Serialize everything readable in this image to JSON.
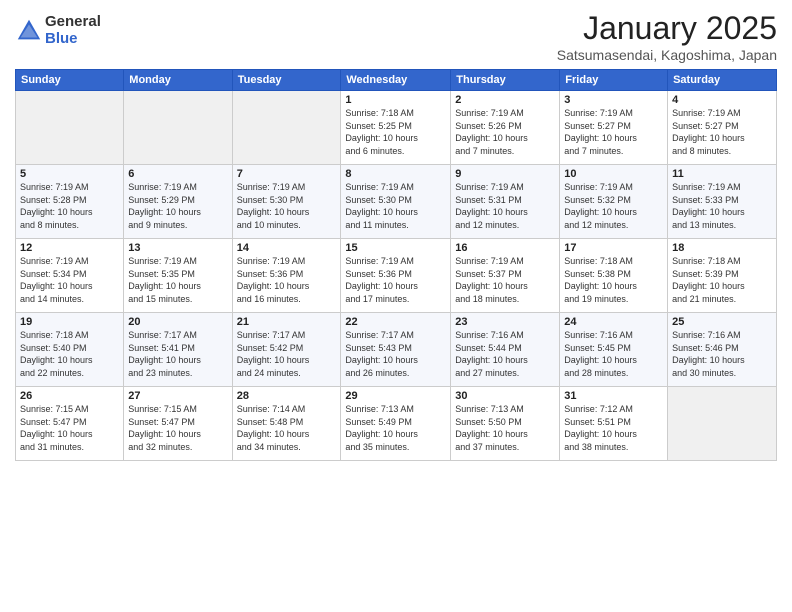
{
  "logo": {
    "general": "General",
    "blue": "Blue"
  },
  "title": {
    "month_year": "January 2025",
    "location": "Satsumasendai, Kagoshima, Japan"
  },
  "weekdays": [
    "Sunday",
    "Monday",
    "Tuesday",
    "Wednesday",
    "Thursday",
    "Friday",
    "Saturday"
  ],
  "weeks": [
    [
      {
        "day": "",
        "info": ""
      },
      {
        "day": "",
        "info": ""
      },
      {
        "day": "",
        "info": ""
      },
      {
        "day": "1",
        "info": "Sunrise: 7:18 AM\nSunset: 5:25 PM\nDaylight: 10 hours\nand 6 minutes."
      },
      {
        "day": "2",
        "info": "Sunrise: 7:19 AM\nSunset: 5:26 PM\nDaylight: 10 hours\nand 7 minutes."
      },
      {
        "day": "3",
        "info": "Sunrise: 7:19 AM\nSunset: 5:27 PM\nDaylight: 10 hours\nand 7 minutes."
      },
      {
        "day": "4",
        "info": "Sunrise: 7:19 AM\nSunset: 5:27 PM\nDaylight: 10 hours\nand 8 minutes."
      }
    ],
    [
      {
        "day": "5",
        "info": "Sunrise: 7:19 AM\nSunset: 5:28 PM\nDaylight: 10 hours\nand 8 minutes."
      },
      {
        "day": "6",
        "info": "Sunrise: 7:19 AM\nSunset: 5:29 PM\nDaylight: 10 hours\nand 9 minutes."
      },
      {
        "day": "7",
        "info": "Sunrise: 7:19 AM\nSunset: 5:30 PM\nDaylight: 10 hours\nand 10 minutes."
      },
      {
        "day": "8",
        "info": "Sunrise: 7:19 AM\nSunset: 5:30 PM\nDaylight: 10 hours\nand 11 minutes."
      },
      {
        "day": "9",
        "info": "Sunrise: 7:19 AM\nSunset: 5:31 PM\nDaylight: 10 hours\nand 12 minutes."
      },
      {
        "day": "10",
        "info": "Sunrise: 7:19 AM\nSunset: 5:32 PM\nDaylight: 10 hours\nand 12 minutes."
      },
      {
        "day": "11",
        "info": "Sunrise: 7:19 AM\nSunset: 5:33 PM\nDaylight: 10 hours\nand 13 minutes."
      }
    ],
    [
      {
        "day": "12",
        "info": "Sunrise: 7:19 AM\nSunset: 5:34 PM\nDaylight: 10 hours\nand 14 minutes."
      },
      {
        "day": "13",
        "info": "Sunrise: 7:19 AM\nSunset: 5:35 PM\nDaylight: 10 hours\nand 15 minutes."
      },
      {
        "day": "14",
        "info": "Sunrise: 7:19 AM\nSunset: 5:36 PM\nDaylight: 10 hours\nand 16 minutes."
      },
      {
        "day": "15",
        "info": "Sunrise: 7:19 AM\nSunset: 5:36 PM\nDaylight: 10 hours\nand 17 minutes."
      },
      {
        "day": "16",
        "info": "Sunrise: 7:19 AM\nSunset: 5:37 PM\nDaylight: 10 hours\nand 18 minutes."
      },
      {
        "day": "17",
        "info": "Sunrise: 7:18 AM\nSunset: 5:38 PM\nDaylight: 10 hours\nand 19 minutes."
      },
      {
        "day": "18",
        "info": "Sunrise: 7:18 AM\nSunset: 5:39 PM\nDaylight: 10 hours\nand 21 minutes."
      }
    ],
    [
      {
        "day": "19",
        "info": "Sunrise: 7:18 AM\nSunset: 5:40 PM\nDaylight: 10 hours\nand 22 minutes."
      },
      {
        "day": "20",
        "info": "Sunrise: 7:17 AM\nSunset: 5:41 PM\nDaylight: 10 hours\nand 23 minutes."
      },
      {
        "day": "21",
        "info": "Sunrise: 7:17 AM\nSunset: 5:42 PM\nDaylight: 10 hours\nand 24 minutes."
      },
      {
        "day": "22",
        "info": "Sunrise: 7:17 AM\nSunset: 5:43 PM\nDaylight: 10 hours\nand 26 minutes."
      },
      {
        "day": "23",
        "info": "Sunrise: 7:16 AM\nSunset: 5:44 PM\nDaylight: 10 hours\nand 27 minutes."
      },
      {
        "day": "24",
        "info": "Sunrise: 7:16 AM\nSunset: 5:45 PM\nDaylight: 10 hours\nand 28 minutes."
      },
      {
        "day": "25",
        "info": "Sunrise: 7:16 AM\nSunset: 5:46 PM\nDaylight: 10 hours\nand 30 minutes."
      }
    ],
    [
      {
        "day": "26",
        "info": "Sunrise: 7:15 AM\nSunset: 5:47 PM\nDaylight: 10 hours\nand 31 minutes."
      },
      {
        "day": "27",
        "info": "Sunrise: 7:15 AM\nSunset: 5:47 PM\nDaylight: 10 hours\nand 32 minutes."
      },
      {
        "day": "28",
        "info": "Sunrise: 7:14 AM\nSunset: 5:48 PM\nDaylight: 10 hours\nand 34 minutes."
      },
      {
        "day": "29",
        "info": "Sunrise: 7:13 AM\nSunset: 5:49 PM\nDaylight: 10 hours\nand 35 minutes."
      },
      {
        "day": "30",
        "info": "Sunrise: 7:13 AM\nSunset: 5:50 PM\nDaylight: 10 hours\nand 37 minutes."
      },
      {
        "day": "31",
        "info": "Sunrise: 7:12 AM\nSunset: 5:51 PM\nDaylight: 10 hours\nand 38 minutes."
      },
      {
        "day": "",
        "info": ""
      }
    ]
  ]
}
